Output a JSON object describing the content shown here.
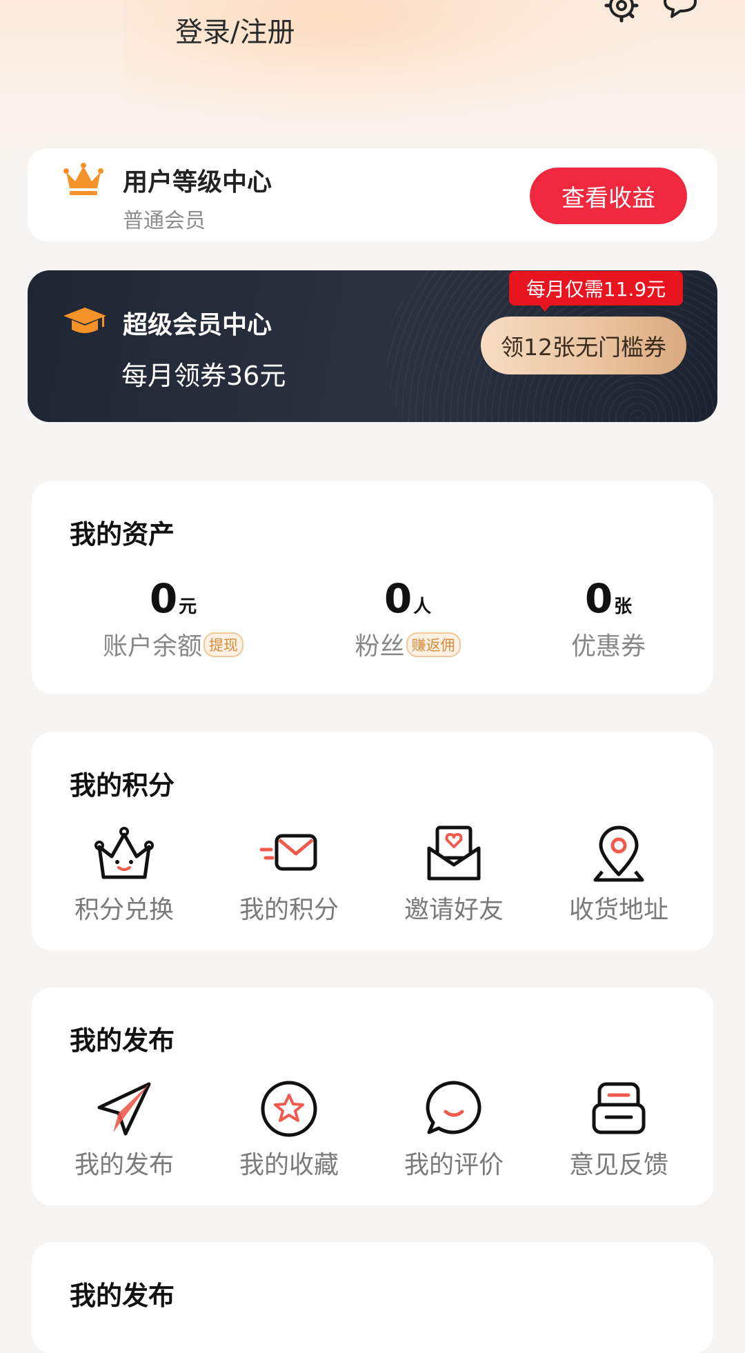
{
  "header": {
    "login_label": "登录/注册",
    "icons": [
      "settings-icon",
      "message-icon"
    ]
  },
  "level_card": {
    "title": "用户等级中心",
    "subtitle": "普通会员",
    "button_label": "查看收益",
    "accent_color": "#f0283e"
  },
  "vip_card": {
    "title": "超级会员中心",
    "subtitle": "每月领券36元",
    "tag": "每月仅需11.9元",
    "button_label": "领12张无门槛券"
  },
  "assets": {
    "title": "我的资产",
    "items": [
      {
        "value": "0",
        "unit": "元",
        "label": "账户余额",
        "badge": "提现"
      },
      {
        "value": "0",
        "unit": "人",
        "label": "粉丝",
        "badge": "赚返佣"
      },
      {
        "value": "0",
        "unit": "张",
        "label": "优惠券",
        "badge": ""
      }
    ]
  },
  "points": {
    "title": "我的积分",
    "items": [
      {
        "label": "积分兑换",
        "icon": "crown-smile-icon"
      },
      {
        "label": "我的积分",
        "icon": "envelope-fast-icon"
      },
      {
        "label": "邀请好友",
        "icon": "heart-letter-icon"
      },
      {
        "label": "收货地址",
        "icon": "location-pin-icon"
      }
    ]
  },
  "publish": {
    "title": "我的发布",
    "items": [
      {
        "label": "我的发布",
        "icon": "paper-plane-icon"
      },
      {
        "label": "我的收藏",
        "icon": "star-circle-icon"
      },
      {
        "label": "我的评价",
        "icon": "chat-bubble-icon"
      },
      {
        "label": "意见反馈",
        "icon": "feedback-box-icon"
      }
    ]
  },
  "more_section": {
    "title": "我的发布"
  }
}
